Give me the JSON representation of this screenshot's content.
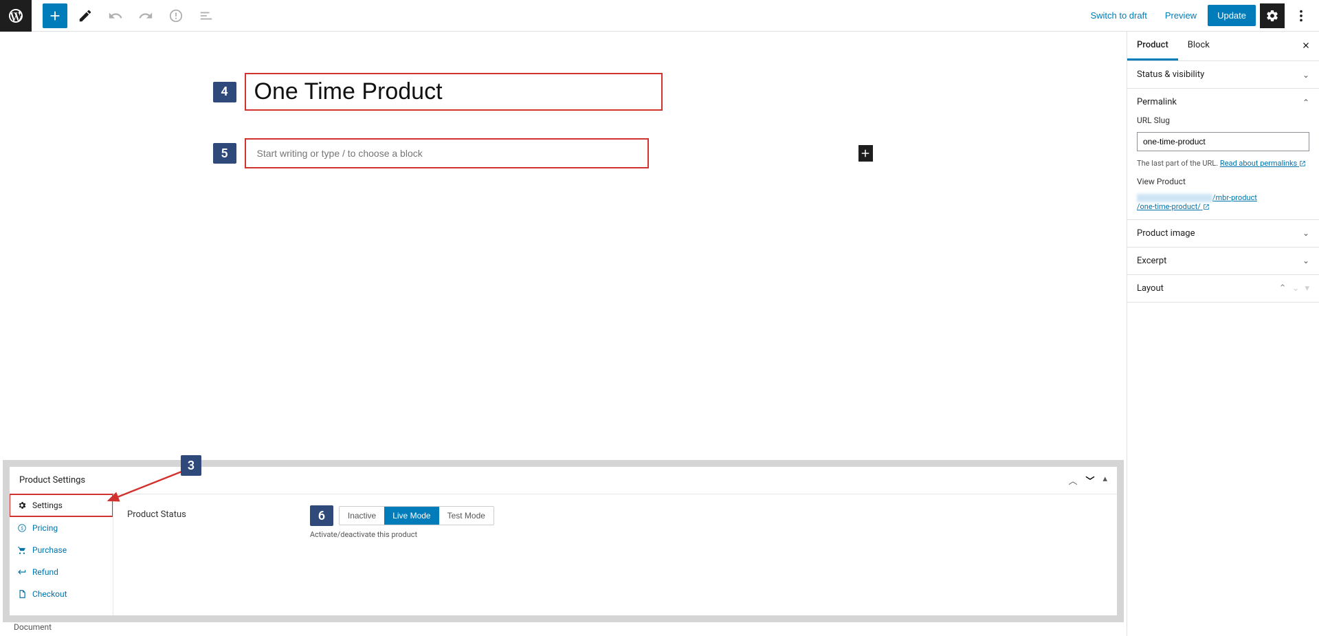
{
  "topbar": {
    "switch_draft": "Switch to draft",
    "preview": "Preview",
    "update": "Update"
  },
  "editor": {
    "title": "One Time Product",
    "body_placeholder": "Start writing or type / to choose a block"
  },
  "callouts": {
    "c3": "3",
    "c4": "4",
    "c5": "5",
    "c6": "6"
  },
  "panel": {
    "title": "Product Settings",
    "nav": {
      "settings": "Settings",
      "pricing": "Pricing",
      "purchase": "Purchase",
      "refund": "Refund",
      "checkout": "Checkout"
    },
    "status_label": "Product Status",
    "status_options": {
      "inactive": "Inactive",
      "live": "Live Mode",
      "test": "Test Mode"
    },
    "status_help": "Activate/deactivate this product"
  },
  "footer": {
    "label": "Document"
  },
  "sidebar": {
    "tabs": {
      "product": "Product",
      "block": "Block"
    },
    "status_visibility": "Status & visibility",
    "permalink": {
      "title": "Permalink",
      "slug_label": "URL Slug",
      "slug_value": "one-time-product",
      "help_prefix": "The last part of the URL. ",
      "help_link": "Read about permalinks",
      "view_label": "View Product",
      "url_suffix": "/mbr-product",
      "url_line2": "/one-time-product/"
    },
    "product_image": "Product image",
    "excerpt": "Excerpt",
    "layout": "Layout"
  }
}
